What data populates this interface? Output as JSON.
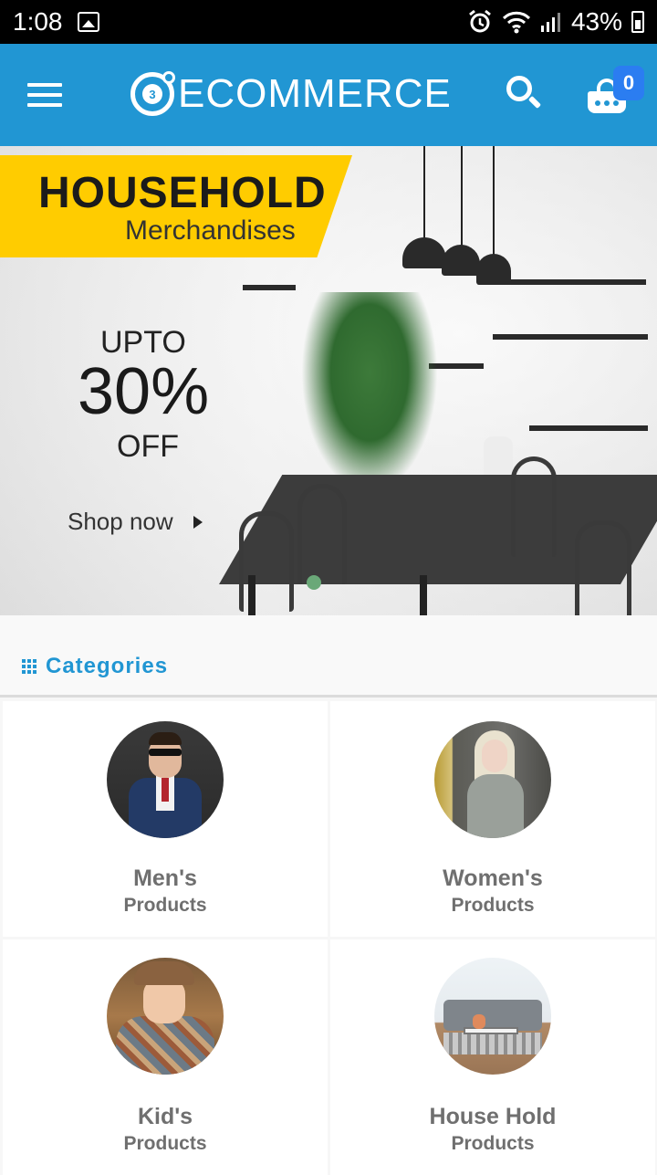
{
  "status_bar": {
    "time": "1:08",
    "battery": "43%",
    "icons": [
      "image-icon",
      "alarm-icon",
      "wifi-icon",
      "signal-icon",
      "battery-icon"
    ]
  },
  "app_bar": {
    "logo_badge": "3",
    "logo_text": "ECOMMERCE",
    "cart_count": "0",
    "colors": {
      "background": "#2196d3",
      "badge": "#2b7df1"
    }
  },
  "banner": {
    "heading": "HOUSEHOLD",
    "subheading": "Merchandises",
    "offer_upto": "UPTO",
    "offer_percent": "30%",
    "offer_off": "OFF",
    "cta": "Shop now",
    "colors": {
      "tag": "#ffcc00",
      "carousel_dot": "#6aa878"
    }
  },
  "categories": {
    "title": "Categories",
    "items": [
      {
        "name": "Men's",
        "sub": "Products"
      },
      {
        "name": "Women's",
        "sub": "Products"
      },
      {
        "name": "Kid's",
        "sub": "Products"
      },
      {
        "name": "House Hold",
        "sub": "Products"
      }
    ]
  }
}
